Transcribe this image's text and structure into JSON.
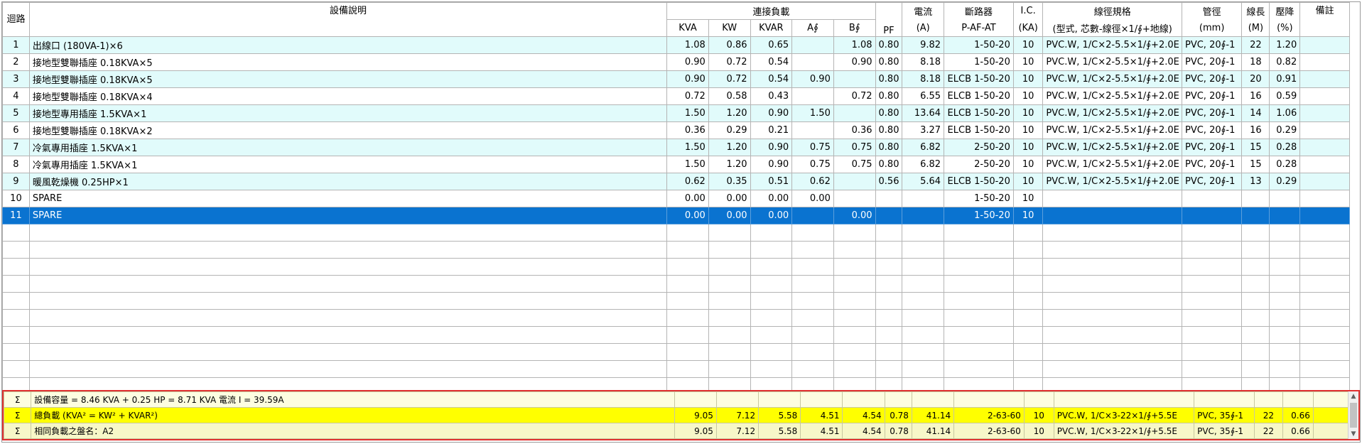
{
  "headers": {
    "circuit": "迴路",
    "description": "設備說明",
    "connected_load": "連接負載",
    "kva": "KVA",
    "kw": "KW",
    "kvar": "KVAR",
    "a_phase": "A∮",
    "b_phase": "B∮",
    "pf": "PF",
    "current": "電流",
    "current_unit": "(A)",
    "breaker": "斷路器",
    "breaker_sub": "P-AF-AT",
    "ic": "I.C.",
    "ic_unit": "(KA)",
    "wire": "線徑規格",
    "wire_sub": "(型式, 芯數-線徑×1/∮+地線)",
    "conduit": "管徑",
    "conduit_unit": "(mm)",
    "length": "線長",
    "length_unit": "(M)",
    "vdrop": "壓降",
    "vdrop_unit": "(%)",
    "remark": "備註"
  },
  "rows": [
    {
      "no": "1",
      "desc": "出線口 (180VA-1)×6",
      "kva": "1.08",
      "kw": "0.86",
      "kvar": "0.65",
      "a": "",
      "b": "1.08",
      "pf": "0.80",
      "amp": "9.82",
      "brk": "1-50-20",
      "ic": "10",
      "wire": "PVC.W, 1/C×2-5.5×1/∮+2.0E",
      "conduit": "PVC, 20∮-1",
      "len": "22",
      "vd": "1.20",
      "remark": ""
    },
    {
      "no": "2",
      "desc": "接地型雙聯插座 0.18KVA×5",
      "kva": "0.90",
      "kw": "0.72",
      "kvar": "0.54",
      "a": "",
      "b": "0.90",
      "pf": "0.80",
      "amp": "8.18",
      "brk": "1-50-20",
      "ic": "10",
      "wire": "PVC.W, 1/C×2-5.5×1/∮+2.0E",
      "conduit": "PVC, 20∮-1",
      "len": "18",
      "vd": "0.82",
      "remark": ""
    },
    {
      "no": "3",
      "desc": "接地型雙聯插座 0.18KVA×5",
      "kva": "0.90",
      "kw": "0.72",
      "kvar": "0.54",
      "a": "0.90",
      "b": "",
      "pf": "0.80",
      "amp": "8.18",
      "brk": "ELCB 1-50-20",
      "ic": "10",
      "wire": "PVC.W, 1/C×2-5.5×1/∮+2.0E",
      "conduit": "PVC, 20∮-1",
      "len": "20",
      "vd": "0.91",
      "remark": ""
    },
    {
      "no": "4",
      "desc": "接地型雙聯插座 0.18KVA×4",
      "kva": "0.72",
      "kw": "0.58",
      "kvar": "0.43",
      "a": "",
      "b": "0.72",
      "pf": "0.80",
      "amp": "6.55",
      "brk": "ELCB 1-50-20",
      "ic": "10",
      "wire": "PVC.W, 1/C×2-5.5×1/∮+2.0E",
      "conduit": "PVC, 20∮-1",
      "len": "16",
      "vd": "0.59",
      "remark": ""
    },
    {
      "no": "5",
      "desc": "接地型專用插座 1.5KVA×1",
      "kva": "1.50",
      "kw": "1.20",
      "kvar": "0.90",
      "a": "1.50",
      "b": "",
      "pf": "0.80",
      "amp": "13.64",
      "brk": "ELCB 1-50-20",
      "ic": "10",
      "wire": "PVC.W, 1/C×2-5.5×1/∮+2.0E",
      "conduit": "PVC, 20∮-1",
      "len": "14",
      "vd": "1.06",
      "remark": ""
    },
    {
      "no": "6",
      "desc": "接地型雙聯插座 0.18KVA×2",
      "kva": "0.36",
      "kw": "0.29",
      "kvar": "0.21",
      "a": "",
      "b": "0.36",
      "pf": "0.80",
      "amp": "3.27",
      "brk": "ELCB 1-50-20",
      "ic": "10",
      "wire": "PVC.W, 1/C×2-5.5×1/∮+2.0E",
      "conduit": "PVC, 20∮-1",
      "len": "16",
      "vd": "0.29",
      "remark": ""
    },
    {
      "no": "7",
      "desc": "冷氣專用插座 1.5KVA×1",
      "kva": "1.50",
      "kw": "1.20",
      "kvar": "0.90",
      "a": "0.75",
      "b": "0.75",
      "pf": "0.80",
      "amp": "6.82",
      "brk": "2-50-20",
      "ic": "10",
      "wire": "PVC.W, 1/C×2-5.5×1/∮+2.0E",
      "conduit": "PVC, 20∮-1",
      "len": "15",
      "vd": "0.28",
      "remark": ""
    },
    {
      "no": "8",
      "desc": "冷氣專用插座 1.5KVA×1",
      "kva": "1.50",
      "kw": "1.20",
      "kvar": "0.90",
      "a": "0.75",
      "b": "0.75",
      "pf": "0.80",
      "amp": "6.82",
      "brk": "2-50-20",
      "ic": "10",
      "wire": "PVC.W, 1/C×2-5.5×1/∮+2.0E",
      "conduit": "PVC, 20∮-1",
      "len": "15",
      "vd": "0.28",
      "remark": ""
    },
    {
      "no": "9",
      "desc": "暖風乾燥機 0.25HP×1",
      "kva": "0.62",
      "kw": "0.35",
      "kvar": "0.51",
      "a": "0.62",
      "b": "",
      "pf": "0.56",
      "amp": "5.64",
      "brk": "ELCB 1-50-20",
      "ic": "10",
      "wire": "PVC.W, 1/C×2-5.5×1/∮+2.0E",
      "conduit": "PVC, 20∮-1",
      "len": "13",
      "vd": "0.29",
      "remark": ""
    },
    {
      "no": "10",
      "desc": "SPARE",
      "kva": "0.00",
      "kw": "0.00",
      "kvar": "0.00",
      "a": "0.00",
      "b": "",
      "pf": "",
      "amp": "",
      "brk": "1-50-20",
      "ic": "10",
      "wire": "",
      "conduit": "",
      "len": "",
      "vd": "",
      "remark": ""
    },
    {
      "no": "11",
      "desc": "SPARE",
      "kva": "0.00",
      "kw": "0.00",
      "kvar": "0.00",
      "a": "",
      "b": "0.00",
      "pf": "",
      "amp": "",
      "brk": "1-50-20",
      "ic": "10",
      "wire": "",
      "conduit": "",
      "len": "",
      "vd": "",
      "remark": ""
    }
  ],
  "row_styles": [
    "cyan",
    "white",
    "cyan",
    "white",
    "cyan",
    "white",
    "cyan",
    "white",
    "cyan",
    "white",
    "sel"
  ],
  "empty_row_count": 10,
  "summary": [
    {
      "sigma": "Σ",
      "desc": "設備容量 = 8.46 KVA + 0.25 HP = 8.71 KVA 電流 I = 39.59A",
      "kva": "",
      "kw": "",
      "kvar": "",
      "a": "",
      "b": "",
      "pf": "",
      "amp": "",
      "brk": "",
      "ic": "",
      "wire": "",
      "conduit": "",
      "len": "",
      "vd": ""
    },
    {
      "sigma": "Σ",
      "desc": "總負載 (KVA² = KW² + KVAR²)",
      "kva": "9.05",
      "kw": "7.12",
      "kvar": "5.58",
      "a": "4.51",
      "b": "4.54",
      "pf": "0.78",
      "amp": "41.14",
      "brk": "2-63-60",
      "ic": "10",
      "wire": "PVC.W, 1/C×3-22×1/∮+5.5E",
      "conduit": "PVC, 35∮-1",
      "len": "22",
      "vd": "0.66"
    },
    {
      "sigma": "Σ",
      "desc": "相同負載之盤名：A2",
      "kva": "9.05",
      "kw": "7.12",
      "kvar": "5.58",
      "a": "4.51",
      "b": "4.54",
      "pf": "0.78",
      "amp": "41.14",
      "brk": "2-63-60",
      "ic": "10",
      "wire": "PVC.W, 1/C×3-22×1/∮+5.5E",
      "conduit": "PVC, 35∮-1",
      "len": "22",
      "vd": "0.66"
    }
  ],
  "colors": {
    "selected_row": "#0a73d0",
    "alt_row": "#e1fbfb",
    "summary_border": "#e03030",
    "summary_total": "#ffff00"
  },
  "icons": {
    "scroll_up": "scroll-up-arrow-icon",
    "scroll_down": "scroll-down-arrow-icon"
  }
}
